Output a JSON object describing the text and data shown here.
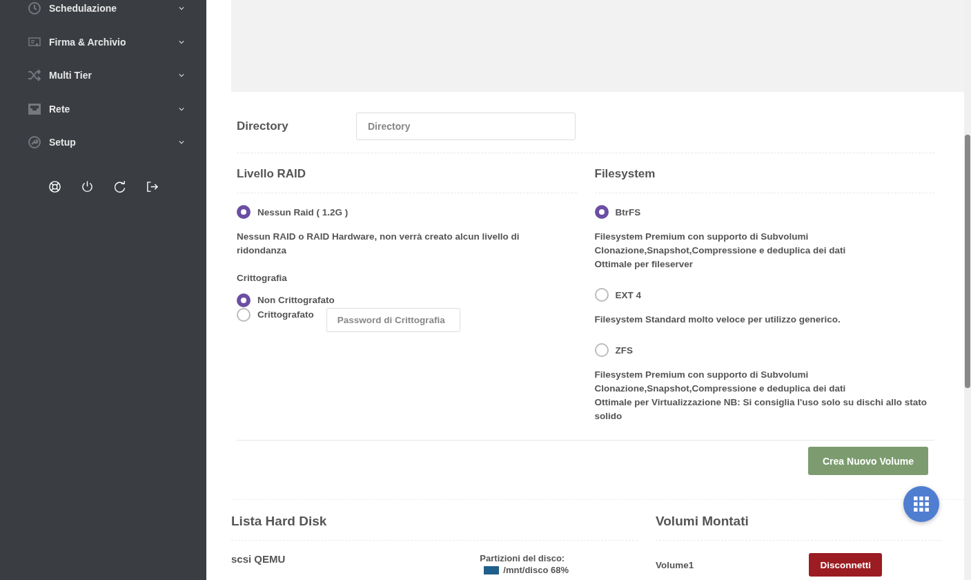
{
  "sidebar": {
    "items": [
      {
        "label": "Schedulazione",
        "expanded": false
      },
      {
        "label": "Firma & Archivio",
        "expanded": false
      },
      {
        "label": "Multi Tier",
        "expanded": false
      },
      {
        "label": "Rete",
        "expanded": false
      },
      {
        "label": "Setup",
        "expanded": false
      }
    ]
  },
  "directory": {
    "label": "Directory",
    "placeholder": "Directory"
  },
  "raid": {
    "title": "Livello RAID",
    "options": [
      {
        "label": "Nessun Raid ( 1.2G )",
        "selected": true,
        "description": "Nessun RAID o RAID Hardware, non verrà creato alcun livello di ridondanza"
      }
    ],
    "encryption": {
      "label": "Crittografia",
      "options": [
        {
          "label": "Non Crittografato",
          "selected": true
        },
        {
          "label": "Crittografato",
          "selected": false
        }
      ],
      "password_placeholder": "Password di Crittografia"
    }
  },
  "filesystem": {
    "title": "Filesystem",
    "options": [
      {
        "label": "BtrFS",
        "selected": true,
        "description": [
          "Filesystem Premium con supporto di Subvolumi",
          "Clonazione,Snapshot,Compressione e deduplica dei dati",
          "Ottimale per fileserver"
        ]
      },
      {
        "label": "EXT 4",
        "selected": false,
        "description": [
          "Filesystem Standard molto veloce per utilizzo generico."
        ]
      },
      {
        "label": "ZFS",
        "selected": false,
        "description": [
          "Filesystem Premium con supporto di Subvolumi",
          "Clonazione,Snapshot,Compressione e deduplica dei dati",
          "Ottimale per Virtualizzazione NB: Si consiglia l'uso solo su dischi allo stato solido"
        ]
      }
    ]
  },
  "create_button": "Crea Nuovo Volume",
  "disks": {
    "title": "Lista Hard Disk",
    "items": [
      {
        "name": "scsi QEMU",
        "partitions_label": "Partizioni del disco:",
        "partitions": [
          {
            "label": "/mnt/disco 68%",
            "color": "#1f5f8b"
          }
        ]
      }
    ]
  },
  "volumes": {
    "title": "Volumi Montati",
    "items": [
      {
        "name": "Volume1",
        "action": "Disconnetti"
      }
    ]
  }
}
